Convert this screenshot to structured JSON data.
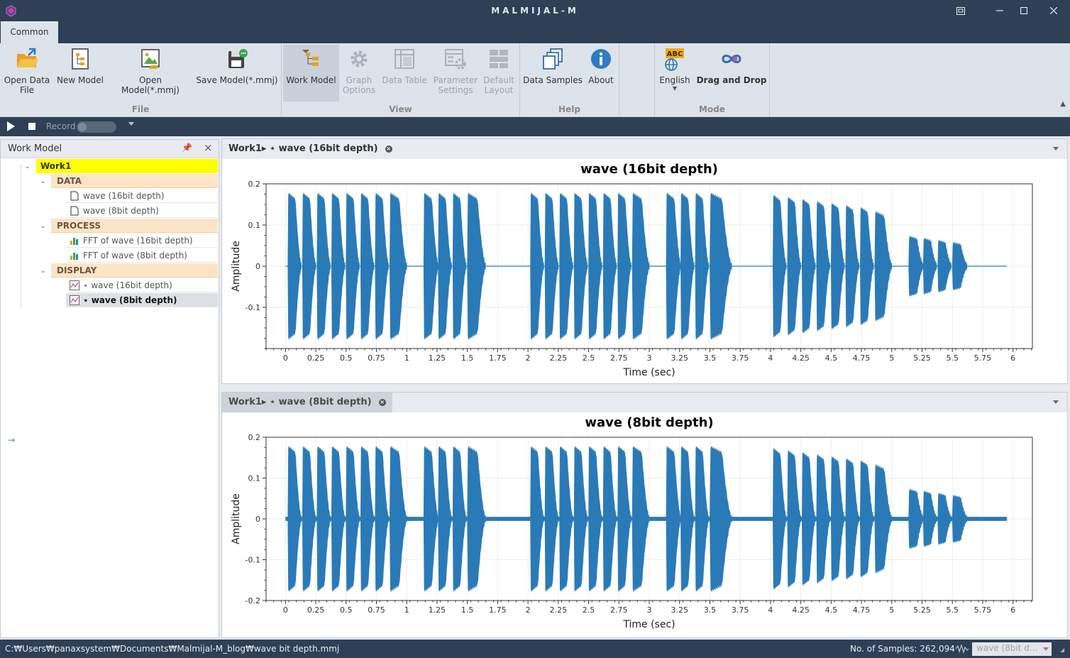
{
  "window": {
    "title": "MALMIJAL-M",
    "controls": [
      "restore",
      "minimize",
      "maximize",
      "close"
    ]
  },
  "ribbon": {
    "tab": "Common",
    "groups": [
      {
        "label": "File",
        "buttons": [
          {
            "line1": "Open Data",
            "line2": "File",
            "icon": "folder-open-icon"
          },
          {
            "line1": "New Model",
            "line2": "",
            "icon": "new-model-icon"
          },
          {
            "line1": "Open Model(*.mmj)",
            "line2": "",
            "icon": "open-model-icon"
          },
          {
            "line1": "Save Model(*.mmj)",
            "line2": "",
            "icon": "save-model-icon"
          }
        ]
      },
      {
        "label": "View",
        "buttons": [
          {
            "line1": "Work Model",
            "line2": "",
            "icon": "work-model-icon",
            "selected": true
          },
          {
            "line1": "Graph",
            "line2": "Options",
            "icon": "gear-icon",
            "disabled": true
          },
          {
            "line1": "Data Table",
            "line2": "",
            "icon": "table-icon",
            "disabled": true
          },
          {
            "line1": "Parameter",
            "line2": "Settings",
            "icon": "parameter-settings-icon",
            "disabled": true
          },
          {
            "line1": "Default",
            "line2": "Layout",
            "icon": "layout-icon",
            "disabled": true
          }
        ]
      },
      {
        "label": "Help",
        "buttons": [
          {
            "line1": "Data Samples",
            "line2": "",
            "icon": "data-samples-icon"
          },
          {
            "line1": "About",
            "line2": "",
            "icon": "info-icon"
          }
        ]
      },
      {
        "label": "Mode",
        "buttons": [
          {
            "line1": "English",
            "line2": "",
            "icon": "language-icon"
          },
          {
            "line1": "Drag and Drop",
            "line2": "",
            "icon": "drag-drop-icon"
          }
        ]
      }
    ]
  },
  "record_bar": {
    "label": "Record"
  },
  "work_model": {
    "title": "Work Model",
    "root": "Work1",
    "categories": [
      {
        "name": "DATA",
        "items": [
          {
            "label": "wave (16bit depth)",
            "icon": "file-icon"
          },
          {
            "label": "wave (8bit depth)",
            "icon": "file-icon"
          }
        ]
      },
      {
        "name": "PROCESS",
        "items": [
          {
            "label": "FFT of wave (16bit depth)",
            "icon": "bar-chart-icon"
          },
          {
            "label": "FFT of wave (8bit depth)",
            "icon": "bar-chart-icon"
          }
        ]
      },
      {
        "name": "DISPLAY",
        "items": [
          {
            "label": "⋆ wave (16bit depth)",
            "icon": "line-chart-icon"
          },
          {
            "label": "⋆ wave (8bit depth)",
            "icon": "line-chart-icon",
            "selected": true
          }
        ]
      }
    ]
  },
  "panes": [
    {
      "tab": "Work1▸ ⋆ wave (16bit depth)"
    },
    {
      "tab": "Work1▸ ⋆ wave (8bit depth)"
    }
  ],
  "chart_data": [
    {
      "type": "line",
      "title": "wave (16bit depth)",
      "xlabel": "Time (sec)",
      "ylabel": "Amplitude",
      "xlim": [
        -0.16,
        6.16
      ],
      "ylim": [
        -0.2,
        0.2
      ],
      "xticks": [
        0,
        0.25,
        0.5,
        0.75,
        1,
        1.25,
        1.5,
        1.75,
        2,
        2.25,
        2.5,
        2.75,
        3,
        3.25,
        3.5,
        3.75,
        4,
        4.25,
        4.5,
        4.75,
        5,
        5.25,
        5.5,
        5.75,
        6
      ],
      "xtick_labels": [
        "0",
        "0.25",
        "0.5",
        "0.75",
        "1",
        "1.25",
        "1.5",
        "1.75",
        "2",
        "2.25",
        "2.5",
        "2.75",
        "3",
        "3.25",
        "3.5",
        "3.75",
        "4",
        "4.25",
        "4.5",
        "4.75",
        "5",
        "5.25",
        "5.5",
        "5.75",
        "6"
      ],
      "yticks": [
        0.2,
        0.1,
        0,
        -0.1
      ],
      "ytick_labels": [
        "0.2",
        "0.1",
        "0",
        "-0.1"
      ],
      "color": "#2a7ab8",
      "noise_floor": 0.0,
      "x_end": 5.95,
      "bursts": [
        {
          "start": 0.02,
          "end": 0.13,
          "amp": 0.175
        },
        {
          "start": 0.14,
          "end": 0.25,
          "amp": 0.175
        },
        {
          "start": 0.26,
          "end": 0.37,
          "amp": 0.175
        },
        {
          "start": 0.38,
          "end": 0.49,
          "amp": 0.175
        },
        {
          "start": 0.5,
          "end": 0.61,
          "amp": 0.175
        },
        {
          "start": 0.62,
          "end": 0.73,
          "amp": 0.175
        },
        {
          "start": 0.74,
          "end": 0.85,
          "amp": 0.175
        },
        {
          "start": 0.86,
          "end": 1.0,
          "amp": 0.175
        },
        {
          "start": 1.14,
          "end": 1.26,
          "amp": 0.175
        },
        {
          "start": 1.26,
          "end": 1.37,
          "amp": 0.175
        },
        {
          "start": 1.38,
          "end": 1.49,
          "amp": 0.175
        },
        {
          "start": 1.5,
          "end": 1.65,
          "amp": 0.175
        },
        {
          "start": 2.02,
          "end": 2.13,
          "amp": 0.175
        },
        {
          "start": 2.14,
          "end": 2.25,
          "amp": 0.175
        },
        {
          "start": 2.26,
          "end": 2.37,
          "amp": 0.175
        },
        {
          "start": 2.38,
          "end": 2.49,
          "amp": 0.175
        },
        {
          "start": 2.5,
          "end": 2.61,
          "amp": 0.175
        },
        {
          "start": 2.62,
          "end": 2.73,
          "amp": 0.175
        },
        {
          "start": 2.74,
          "end": 2.85,
          "amp": 0.175
        },
        {
          "start": 2.86,
          "end": 3.0,
          "amp": 0.175
        },
        {
          "start": 3.14,
          "end": 3.26,
          "amp": 0.175
        },
        {
          "start": 3.26,
          "end": 3.37,
          "amp": 0.175
        },
        {
          "start": 3.38,
          "end": 3.49,
          "amp": 0.175
        },
        {
          "start": 3.5,
          "end": 3.68,
          "amp": 0.175
        },
        {
          "start": 4.02,
          "end": 4.13,
          "amp": 0.17
        },
        {
          "start": 4.14,
          "end": 4.25,
          "amp": 0.165
        },
        {
          "start": 4.26,
          "end": 4.37,
          "amp": 0.16
        },
        {
          "start": 4.38,
          "end": 4.49,
          "amp": 0.155
        },
        {
          "start": 4.5,
          "end": 4.61,
          "amp": 0.15
        },
        {
          "start": 4.62,
          "end": 4.73,
          "amp": 0.145
        },
        {
          "start": 4.74,
          "end": 4.85,
          "amp": 0.14
        },
        {
          "start": 4.86,
          "end": 5.0,
          "amp": 0.13
        },
        {
          "start": 5.14,
          "end": 5.26,
          "amp": 0.07
        },
        {
          "start": 5.26,
          "end": 5.37,
          "amp": 0.065
        },
        {
          "start": 5.38,
          "end": 5.49,
          "amp": 0.06
        },
        {
          "start": 5.5,
          "end": 5.62,
          "amp": 0.055
        }
      ]
    },
    {
      "type": "line",
      "title": "wave (8bit depth)",
      "xlabel": "Time (sec)",
      "ylabel": "Amplitude",
      "xlim": [
        -0.16,
        6.16
      ],
      "ylim": [
        -0.2,
        0.2
      ],
      "xticks": [
        0,
        0.25,
        0.5,
        0.75,
        1,
        1.25,
        1.5,
        1.75,
        2,
        2.25,
        2.5,
        2.75,
        3,
        3.25,
        3.5,
        3.75,
        4,
        4.25,
        4.5,
        4.75,
        5,
        5.25,
        5.5,
        5.75,
        6
      ],
      "xtick_labels": [
        "0",
        "0.25",
        "0.5",
        "0.75",
        "1",
        "1.25",
        "1.5",
        "1.75",
        "2",
        "2.25",
        "2.5",
        "2.75",
        "3",
        "3.25",
        "3.5",
        "3.75",
        "4",
        "4.25",
        "4.5",
        "4.75",
        "5",
        "5.25",
        "5.5",
        "5.75",
        "6"
      ],
      "yticks": [
        0.2,
        0.1,
        0,
        -0.1,
        -0.2
      ],
      "ytick_labels": [
        "0.2",
        "0.1",
        "0",
        "-0.1",
        "-0.2"
      ],
      "color": "#2a7ab8",
      "noise_floor": 0.005,
      "x_end": 5.95,
      "bursts": [
        {
          "start": 0.02,
          "end": 0.13,
          "amp": 0.175
        },
        {
          "start": 0.14,
          "end": 0.25,
          "amp": 0.175
        },
        {
          "start": 0.26,
          "end": 0.37,
          "amp": 0.175
        },
        {
          "start": 0.38,
          "end": 0.49,
          "amp": 0.175
        },
        {
          "start": 0.5,
          "end": 0.61,
          "amp": 0.175
        },
        {
          "start": 0.62,
          "end": 0.73,
          "amp": 0.175
        },
        {
          "start": 0.74,
          "end": 0.85,
          "amp": 0.175
        },
        {
          "start": 0.86,
          "end": 1.0,
          "amp": 0.175
        },
        {
          "start": 1.14,
          "end": 1.26,
          "amp": 0.175
        },
        {
          "start": 1.26,
          "end": 1.37,
          "amp": 0.175
        },
        {
          "start": 1.38,
          "end": 1.49,
          "amp": 0.175
        },
        {
          "start": 1.5,
          "end": 1.65,
          "amp": 0.175
        },
        {
          "start": 2.02,
          "end": 2.13,
          "amp": 0.175
        },
        {
          "start": 2.14,
          "end": 2.25,
          "amp": 0.175
        },
        {
          "start": 2.26,
          "end": 2.37,
          "amp": 0.175
        },
        {
          "start": 2.38,
          "end": 2.49,
          "amp": 0.175
        },
        {
          "start": 2.5,
          "end": 2.61,
          "amp": 0.175
        },
        {
          "start": 2.62,
          "end": 2.73,
          "amp": 0.175
        },
        {
          "start": 2.74,
          "end": 2.85,
          "amp": 0.175
        },
        {
          "start": 2.86,
          "end": 3.0,
          "amp": 0.175
        },
        {
          "start": 3.14,
          "end": 3.26,
          "amp": 0.175
        },
        {
          "start": 3.26,
          "end": 3.37,
          "amp": 0.175
        },
        {
          "start": 3.38,
          "end": 3.49,
          "amp": 0.175
        },
        {
          "start": 3.5,
          "end": 3.68,
          "amp": 0.175
        },
        {
          "start": 4.02,
          "end": 4.13,
          "amp": 0.17
        },
        {
          "start": 4.14,
          "end": 4.25,
          "amp": 0.165
        },
        {
          "start": 4.26,
          "end": 4.37,
          "amp": 0.16
        },
        {
          "start": 4.38,
          "end": 4.49,
          "amp": 0.155
        },
        {
          "start": 4.5,
          "end": 4.61,
          "amp": 0.15
        },
        {
          "start": 4.62,
          "end": 4.73,
          "amp": 0.145
        },
        {
          "start": 4.74,
          "end": 4.85,
          "amp": 0.14
        },
        {
          "start": 4.86,
          "end": 5.0,
          "amp": 0.13
        },
        {
          "start": 5.14,
          "end": 5.26,
          "amp": 0.07
        },
        {
          "start": 5.26,
          "end": 5.37,
          "amp": 0.065
        },
        {
          "start": 5.38,
          "end": 5.49,
          "amp": 0.06
        },
        {
          "start": 5.5,
          "end": 5.62,
          "amp": 0.055
        }
      ]
    }
  ],
  "status": {
    "path": "C:₩Users₩panaxsystem₩Documents₩Malmijal-M_blog₩wave bit depth.mmj",
    "samples": "No. of Samples: 262,094",
    "selected": "wave (8bit d..."
  }
}
